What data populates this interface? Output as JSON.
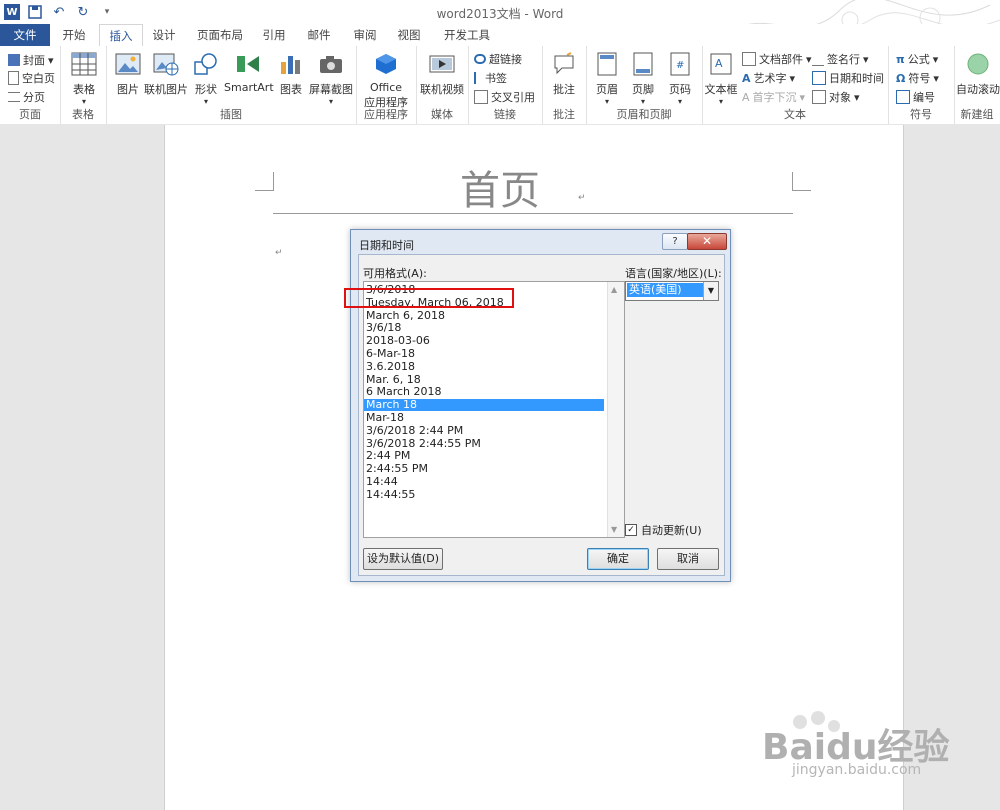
{
  "window": {
    "title": "word2013文档 - Word"
  },
  "tabs": [
    {
      "label": "文件"
    },
    {
      "label": "开始"
    },
    {
      "label": "插入"
    },
    {
      "label": "设计"
    },
    {
      "label": "页面布局"
    },
    {
      "label": "引用"
    },
    {
      "label": "邮件"
    },
    {
      "label": "审阅"
    },
    {
      "label": "视图"
    },
    {
      "label": "开发工具"
    }
  ],
  "ribbon": {
    "pages": {
      "label": "页面",
      "cover": "封面",
      "blank": "空白页",
      "break": "分页"
    },
    "tables": {
      "label": "表格",
      "table": "表格"
    },
    "illustrations": {
      "label": "插图",
      "picture": "图片",
      "online_picture": "联机图片",
      "shapes": "形状",
      "smartart": "SmartArt",
      "chart": "图表",
      "screenshot": "屏幕截图"
    },
    "apps": {
      "label": "应用程序",
      "office_line1": "Office",
      "office_line2": "应用程序"
    },
    "media": {
      "label": "媒体",
      "online_video": "联机视频"
    },
    "links": {
      "label": "链接",
      "hyperlink": "超链接",
      "bookmark": "书签",
      "crossref": "交叉引用"
    },
    "comments": {
      "label": "批注",
      "comment": "批注"
    },
    "headerfooter": {
      "label": "页眉和页脚",
      "header": "页眉",
      "footer": "页脚",
      "pagenum": "页码"
    },
    "text": {
      "label": "文本",
      "textbox": "文本框",
      "quickparts": "文档部件",
      "wordart": "艺术字",
      "dropcap": "首字下沉",
      "signature": "签名行",
      "datetime": "日期和时间",
      "object": "对象"
    },
    "symbols": {
      "label": "符号",
      "equation": "公式",
      "symbol": "符号",
      "number": "编号"
    },
    "newgroup": {
      "label": "新建组",
      "autoscroll": "自动滚动"
    }
  },
  "document": {
    "header_text": "首页",
    "para_mark": "↵"
  },
  "dialog": {
    "title": "日期和时间",
    "help": "?",
    "close": "✕",
    "formats_label": "可用格式(A):",
    "formats": [
      "3/6/2018",
      "Tuesday, March 06, 2018",
      "March 6, 2018",
      "3/6/18",
      "2018-03-06",
      "6-Mar-18",
      "3.6.2018",
      "Mar. 6, 18",
      "6 March 2018",
      "March 18",
      "Mar-18",
      "3/6/2018 2:44 PM",
      "3/6/2018 2:44:55 PM",
      "2:44 PM",
      "2:44:55 PM",
      "14:44",
      "14:44:55"
    ],
    "selected_format": "March 18",
    "language_label": "语言(国家/地区)(L):",
    "language_value": "英语(美国)",
    "auto_update_label": "自动更新(U)",
    "auto_update_checked": true,
    "set_default_label": "设为默认值(D)",
    "ok_label": "确定",
    "cancel_label": "取消"
  },
  "watermark": {
    "brand": "Baidu经验",
    "url": "jingyan.baidu.com"
  }
}
